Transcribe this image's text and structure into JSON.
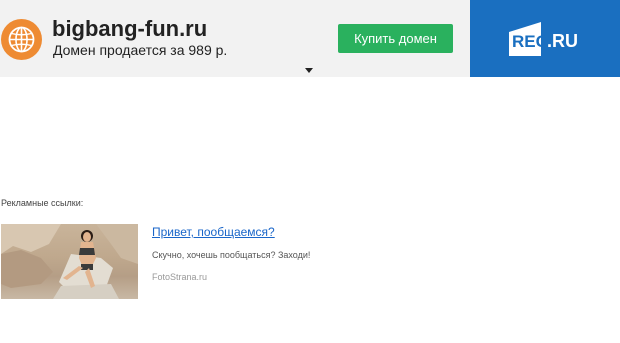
{
  "header": {
    "domain": "bigbang-fun.ru",
    "sale_text": "Домен продается за 989 р.",
    "buy_button": "Купить домен",
    "brand_prefix": "REG",
    "brand_suffix": ".RU",
    "globe_icon": "globe-icon",
    "globe_color": "#ee8b33",
    "buy_color": "#2ab15e",
    "brand_color": "#1a6fc0"
  },
  "ads": {
    "label": "Рекламные ссылки:",
    "items": [
      {
        "title": "Привет, пообщаемся?",
        "text": "Скучно, хочешь пообщаться? Заходи!",
        "source": "FotoStrana.ru"
      }
    ]
  }
}
